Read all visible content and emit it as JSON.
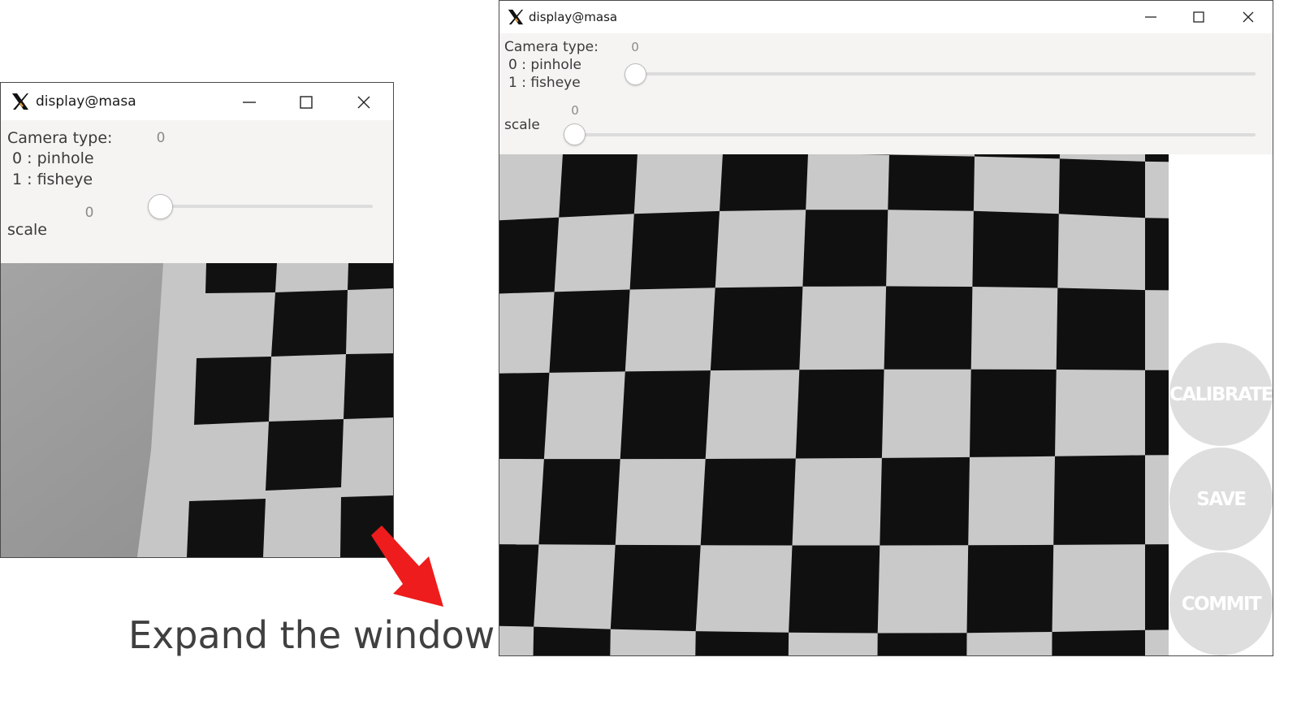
{
  "small_window": {
    "title": "display@masa",
    "camera_type": {
      "label": "Camera type:",
      "option0": "0 : pinhole",
      "option1": "1 : fisheye",
      "value": "0"
    },
    "scale": {
      "label": "scale",
      "value": "0"
    }
  },
  "large_window": {
    "title": "display@masa",
    "camera_type": {
      "label": "Camera type:",
      "option0": "0 : pinhole",
      "option1": "1 : fisheye",
      "value": "0"
    },
    "scale": {
      "label": "scale",
      "value": "0"
    },
    "buttons": {
      "calibrate": "CALIBRATE",
      "save": "SAVE",
      "commit": "COMMIT"
    }
  },
  "caption": "Expand the window",
  "icons": {
    "app": "x11-icon",
    "minimize": "minimize-icon",
    "maximize": "maximize-icon",
    "close": "close-icon",
    "arrow": "arrow-down-right-icon"
  },
  "colors": {
    "arrow": "#ee1c1c",
    "panel": "#f5f4f2",
    "button": "#dedede",
    "checker_dark": "#101010",
    "checker_light": "#c9c9c9"
  }
}
